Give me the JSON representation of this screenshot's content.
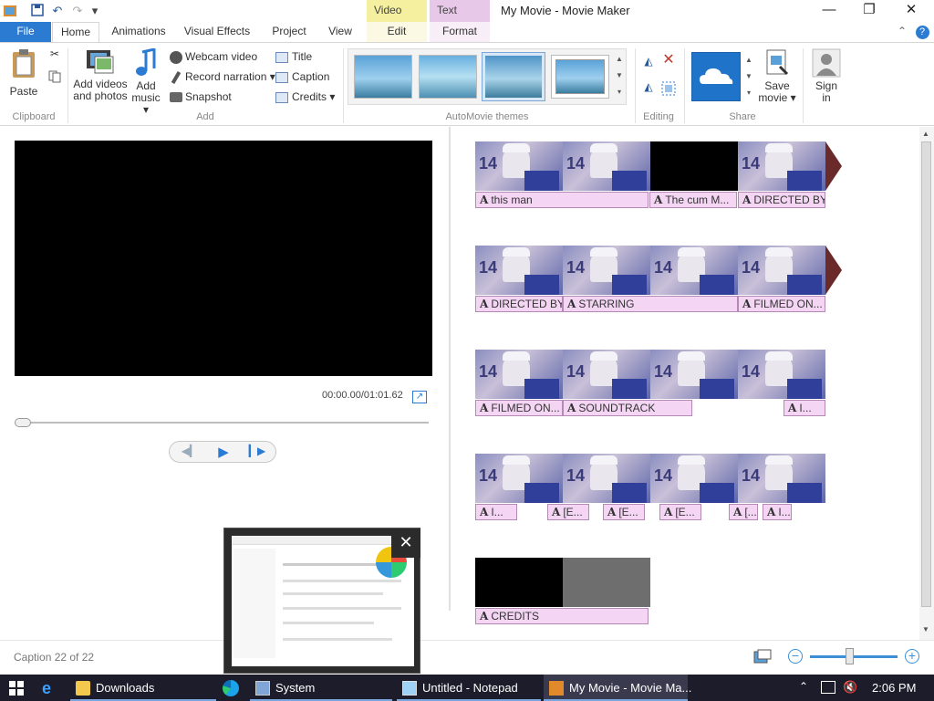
{
  "window": {
    "title": "My Movie - Movie Maker",
    "context_tab_video": "Video Tools",
    "context_tab_text": "Text Tools",
    "minimize": "—",
    "maximize": "❐",
    "close": "✕"
  },
  "tabs": {
    "file": "File",
    "home": "Home",
    "animations": "Animations",
    "visual_effects": "Visual Effects",
    "project": "Project",
    "view": "View",
    "edit": "Edit",
    "format": "Format"
  },
  "ribbon": {
    "clipboard": {
      "label": "Clipboard",
      "paste": "Paste"
    },
    "add": {
      "label": "Add",
      "add_videos_line1": "Add videos",
      "add_videos_line2": "and photos",
      "add_music_line1": "Add",
      "add_music_line2": "music ▾",
      "webcam": "Webcam video",
      "narration": "Record narration ▾",
      "snapshot": "Snapshot",
      "title": "Title",
      "caption": "Caption",
      "credits": "Credits ▾"
    },
    "themes": {
      "label": "AutoMovie themes"
    },
    "editing": {
      "label": "Editing"
    },
    "share": {
      "label": "Share",
      "save_line1": "Save",
      "save_line2": "movie ▾",
      "signin_line1": "Sign",
      "signin_line2": "in"
    }
  },
  "preview": {
    "timecode": "00:00.00/01:01.62",
    "progress": 0
  },
  "storyboard": {
    "captions": [
      {
        "text": "this man",
        "row": 0
      },
      {
        "text": "The cum M...",
        "row": 0
      },
      {
        "text": "DIRECTED BY",
        "row": 0
      },
      {
        "text": "DIRECTED BY",
        "row": 1
      },
      {
        "text": "STARRING",
        "row": 1
      },
      {
        "text": "FILMED ON...",
        "row": 1
      },
      {
        "text": "FILMED ON...",
        "row": 2
      },
      {
        "text": "SOUNDTRACK",
        "row": 2
      },
      {
        "text": "I...",
        "row": 2
      },
      {
        "text": "I...",
        "row": 3
      },
      {
        "text": "[E...",
        "row": 3
      },
      {
        "text": "[E...",
        "row": 3
      },
      {
        "text": "[E...",
        "row": 3
      },
      {
        "text": "[...",
        "row": 3
      },
      {
        "text": "I...",
        "row": 3
      },
      {
        "text": "CREDITS",
        "row": 4
      }
    ]
  },
  "status": {
    "text": "Caption 22 of 22",
    "zoom": 0.45
  },
  "taskbar": {
    "downloads": "Downloads",
    "system": "System",
    "notepad": "Untitled - Notepad",
    "moviemaker": "My Movie - Movie Ma...",
    "clock": "2:06 PM"
  },
  "colors": {
    "accent": "#2b7bd3",
    "caption_bg": "#f4d6f4",
    "video_tools": "#f4f0a0",
    "text_tools": "#e8c8e8",
    "taskbar": "#1c1c2a"
  }
}
